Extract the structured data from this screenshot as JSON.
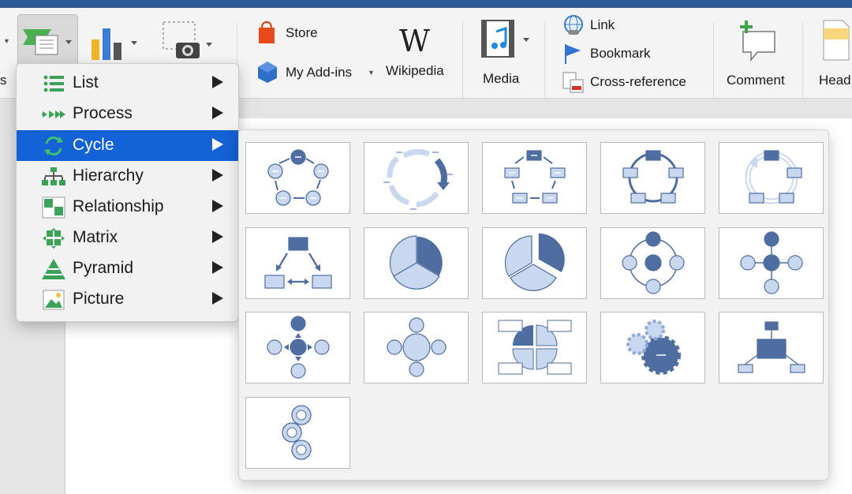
{
  "ribbon": {
    "store_label": "Store",
    "addins_label": "My Add-ins",
    "wikipedia_label": "Wikipedia",
    "media_label": "Media",
    "link_label": "Link",
    "bookmark_label": "Bookmark",
    "crossref_label": "Cross-reference",
    "comment_label": "Comment",
    "header_label": "Head",
    "edge_label": "s",
    "wikipedia_glyph": "W"
  },
  "menu": {
    "items": [
      {
        "label": "List",
        "icon": "list-icon"
      },
      {
        "label": "Process",
        "icon": "process-icon"
      },
      {
        "label": "Cycle",
        "icon": "cycle-icon",
        "selected": true
      },
      {
        "label": "Hierarchy",
        "icon": "hierarchy-icon"
      },
      {
        "label": "Relationship",
        "icon": "relationship-icon"
      },
      {
        "label": "Matrix",
        "icon": "matrix-icon"
      },
      {
        "label": "Pyramid",
        "icon": "pyramid-icon"
      },
      {
        "label": "Picture",
        "icon": "picture-icon"
      }
    ]
  },
  "gallery": {
    "layouts": [
      "basic-cycle",
      "text-cycle",
      "block-cycle",
      "segmented-cycle",
      "continuous-cycle",
      "cycle-matrix",
      "basic-pie",
      "segmented-pie",
      "basic-radial",
      "radial-cluster",
      "diverging-radial",
      "radial-venn",
      "cycle-quadrants",
      "gear",
      "radial-hub",
      "circle-arrow-process"
    ]
  },
  "colors": {
    "accent": "#1361d4",
    "dark_blue": "#4e6ea1",
    "light_blue": "#c9d8ef",
    "titlebar": "#2b5797"
  }
}
